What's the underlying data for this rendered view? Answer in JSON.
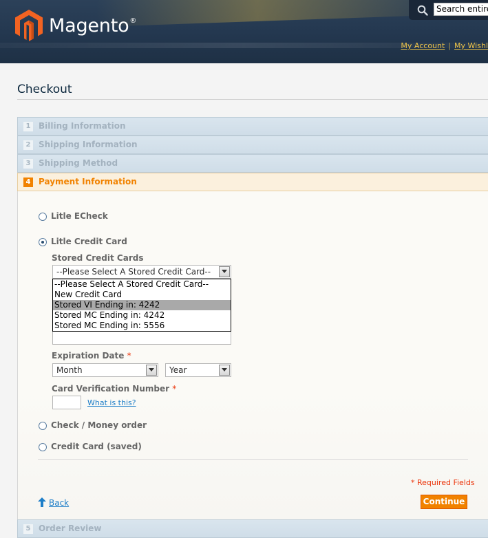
{
  "header": {
    "logo_text": "Magento",
    "logo_reg": "®",
    "search_placeholder": "Search entire store here...",
    "search_value": "Search entire",
    "links": [
      "My Account",
      "My Wishl"
    ]
  },
  "page": {
    "title": "Checkout"
  },
  "steps": [
    {
      "num": "1",
      "label": "Billing Information"
    },
    {
      "num": "2",
      "label": "Shipping Information"
    },
    {
      "num": "3",
      "label": "Shipping Method"
    },
    {
      "num": "4",
      "label": "Payment Information"
    },
    {
      "num": "5",
      "label": "Order Review"
    }
  ],
  "payment": {
    "methods": [
      {
        "label": "Litle ECheck",
        "checked": false
      },
      {
        "label": "Litle Credit Card",
        "checked": true
      },
      {
        "label": "Check / Money order",
        "checked": false
      },
      {
        "label": "Credit Card (saved)",
        "checked": false
      }
    ],
    "stored_cards": {
      "label": "Stored Credit Cards",
      "selected": "--Please Select A Stored Credit Card--",
      "options": [
        "--Please Select A Stored Credit Card--",
        "New Credit Card",
        "Stored VI Ending in: 4242",
        "Stored MC Ending in: 4242",
        "Stored MC Ending in: 5556"
      ],
      "highlighted_index": 2
    },
    "expiration": {
      "label": "Expiration Date",
      "required": "*",
      "month": "Month",
      "year": "Year"
    },
    "cvv": {
      "label": "Card Verification Number",
      "required": "*",
      "help_link": "What is this?"
    }
  },
  "footer": {
    "required_note": "* Required Fields",
    "back_label": "Back",
    "continue_label": "Continue"
  },
  "colors": {
    "accent": "#f18200",
    "link": "#1e7ec8",
    "header_bg": "#243850",
    "required": "#eb340a"
  }
}
